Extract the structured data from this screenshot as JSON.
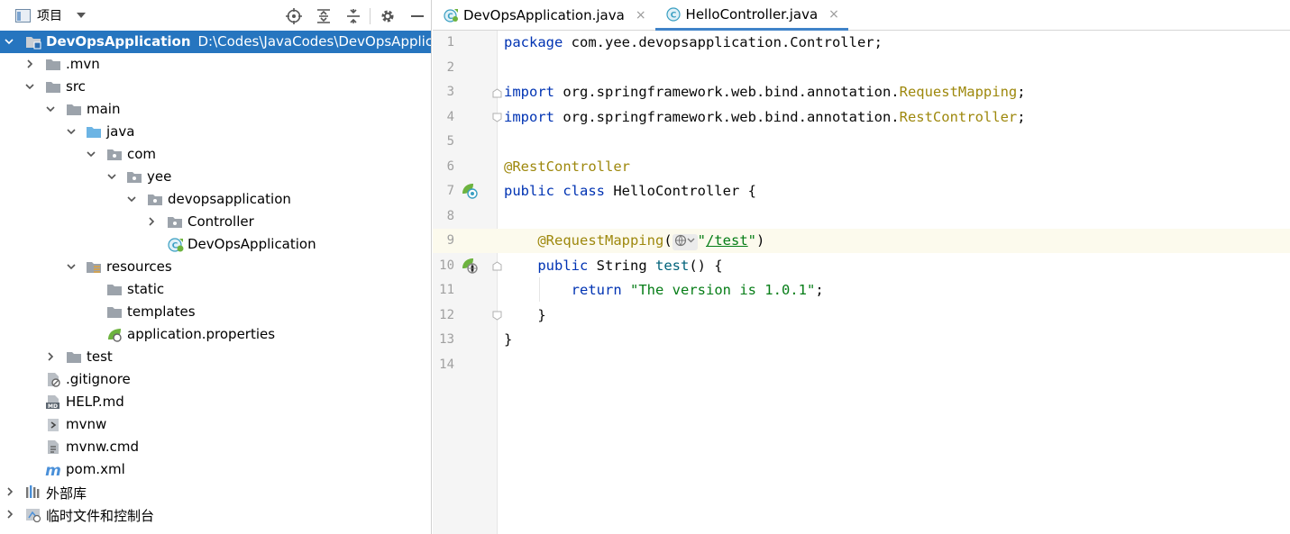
{
  "project_panel": {
    "title": "项目",
    "tools": [
      "locate-icon",
      "expand-all-icon",
      "collapse-all-icon",
      "settings-icon",
      "hide-icon"
    ]
  },
  "tree": [
    {
      "label": "DevOpsApplication",
      "path": "D:\\Codes\\JavaCodes\\DevOpsApplicati",
      "icon": "module-folder-icon",
      "expanded": true,
      "selected": true
    },
    {
      "label": ".mvn",
      "icon": "folder-icon",
      "expanded": false
    },
    {
      "label": "src",
      "icon": "folder-icon",
      "expanded": true
    },
    {
      "label": "main",
      "icon": "folder-icon",
      "expanded": true
    },
    {
      "label": "java",
      "icon": "source-folder-icon",
      "expanded": true
    },
    {
      "label": "com",
      "icon": "package-icon",
      "expanded": true
    },
    {
      "label": "yee",
      "icon": "package-icon",
      "expanded": true
    },
    {
      "label": "devopsapplication",
      "icon": "package-icon",
      "expanded": true
    },
    {
      "label": "Controller",
      "icon": "package-icon",
      "expanded": false
    },
    {
      "label": "DevOpsApplication",
      "icon": "spring-class-icon"
    },
    {
      "label": "resources",
      "icon": "resources-folder-icon",
      "expanded": true
    },
    {
      "label": "static",
      "icon": "folder-icon"
    },
    {
      "label": "templates",
      "icon": "folder-icon"
    },
    {
      "label": "application.properties",
      "icon": "spring-properties-icon"
    },
    {
      "label": "test",
      "icon": "folder-icon",
      "expanded": false
    },
    {
      "label": ".gitignore",
      "icon": "ignore-file-icon"
    },
    {
      "label": "HELP.md",
      "icon": "markdown-file-icon"
    },
    {
      "label": "mvnw",
      "icon": "script-file-icon"
    },
    {
      "label": "mvnw.cmd",
      "icon": "text-file-icon"
    },
    {
      "label": "pom.xml",
      "icon": "maven-icon"
    },
    {
      "label": "外部库",
      "icon": "libraries-icon",
      "expanded": false
    },
    {
      "label": "临时文件和控制台",
      "icon": "scratches-icon",
      "expanded": false
    }
  ],
  "tabs": [
    {
      "label": "DevOpsApplication.java",
      "icon": "spring-class-icon",
      "close": "×",
      "active": false
    },
    {
      "label": "HelloController.java",
      "icon": "class-icon",
      "close": "×",
      "active": true
    }
  ],
  "editor": {
    "line_numbers": [
      "1",
      "2",
      "3",
      "4",
      "5",
      "6",
      "7",
      "8",
      "9",
      "10",
      "11",
      "12",
      "13",
      "14"
    ],
    "current_line": "9",
    "code": {
      "l1_kw": "package",
      "l1_rest": " com.yee.devopsapplication.Controller;",
      "l3_kw": "import",
      "l3_pkg": " org.springframework.web.bind.annotation.",
      "l3_cls": "RequestMapping",
      "l3_end": ";",
      "l4_kw": "import",
      "l4_pkg": " org.springframework.web.bind.annotation.",
      "l4_cls": "RestController",
      "l4_end": ";",
      "l6_ann": "@RestController",
      "l7_kw": "public class",
      "l7_rest": " HelloController {",
      "l9_ann": "@RequestMapping",
      "l9_open": "(",
      "l9_q1": "\"",
      "l9_url": "/test",
      "l9_q2": "\"",
      "l9_close": ")",
      "l10_kw": "public",
      "l10_type": " String ",
      "l10_fn": "test",
      "l10_rest": "() {",
      "l11_kw": "return",
      "l11_sp": " ",
      "l11_str": "\"The version is 1.0.1\"",
      "l11_end": ";",
      "l12": "}",
      "l13": "}"
    }
  },
  "colors": {
    "selection": "#2675bf",
    "keyword": "#0033b3",
    "annotation": "#9e880d",
    "string": "#067d17",
    "method": "#00627a",
    "tab_underline": "#4083c9",
    "current_line": "#fcfaed"
  }
}
